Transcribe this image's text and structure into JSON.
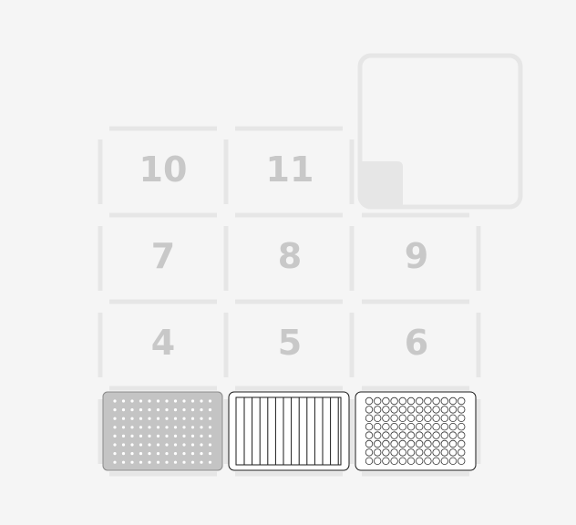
{
  "deck": {
    "slots": [
      {
        "id": "10",
        "label": "10"
      },
      {
        "id": "11",
        "label": "11"
      },
      {
        "id": "7",
        "label": "7"
      },
      {
        "id": "8",
        "label": "8"
      },
      {
        "id": "9",
        "label": "9"
      },
      {
        "id": "4",
        "label": "4"
      },
      {
        "id": "5",
        "label": "5"
      },
      {
        "id": "6",
        "label": "6"
      }
    ],
    "trash": {
      "id": "12"
    },
    "labware": [
      {
        "slot": "1",
        "type": "tiprack",
        "icon": "tiprack-icon",
        "selected": true,
        "rows": 8,
        "cols": 12
      },
      {
        "slot": "2",
        "type": "reservoir",
        "icon": "reservoir-icon",
        "selected": false,
        "channels": 12
      },
      {
        "slot": "3",
        "type": "well-plate",
        "icon": "well-plate-icon",
        "selected": false,
        "rows": 8,
        "cols": 12
      }
    ],
    "colors": {
      "background": "#f5f5f5",
      "slot_outline": "#e6e6e6",
      "slot_label": "#c8c8c8",
      "labware_outline": "#1a1a1a",
      "selected_fill": "#c4c4c4",
      "well_stroke": "#333333"
    }
  }
}
